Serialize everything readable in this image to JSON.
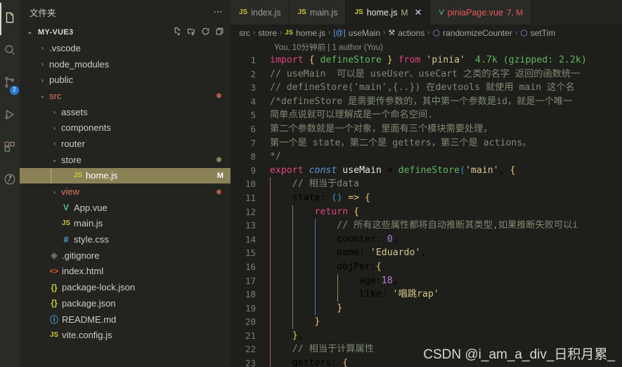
{
  "activitybar": {
    "items": [
      {
        "name": "explorer",
        "icon": "files-icon",
        "active": true,
        "badge": ""
      },
      {
        "name": "search",
        "icon": "search-icon",
        "active": false,
        "badge": ""
      },
      {
        "name": "source-control",
        "icon": "source-control-icon",
        "active": false,
        "badge": "2"
      },
      {
        "name": "run-and-debug",
        "icon": "run-debug-icon",
        "active": false,
        "badge": ""
      },
      {
        "name": "extensions",
        "icon": "extensions-icon",
        "active": false,
        "badge": ""
      },
      {
        "name": "testing",
        "icon": "testing-beaker-icon",
        "active": false,
        "badge": ""
      }
    ]
  },
  "sidebar": {
    "title": "文件夹",
    "more_label": "⋯",
    "project": "MY-VUE3",
    "actions": [
      "new-file-icon",
      "new-folder-icon",
      "refresh-icon",
      "collapse-all-icon"
    ],
    "tree": [
      {
        "label": ".vscode",
        "indent": 1,
        "kind": "folder",
        "twisty": "›",
        "color": "#ccccc6",
        "dot": "",
        "badge": ""
      },
      {
        "label": "node_modules",
        "indent": 1,
        "kind": "folder",
        "twisty": "›",
        "color": "#ccccc6",
        "dot": "",
        "badge": ""
      },
      {
        "label": "public",
        "indent": 1,
        "kind": "folder",
        "twisty": "›",
        "color": "#ccccc6",
        "dot": "",
        "badge": ""
      },
      {
        "label": "src",
        "indent": 1,
        "kind": "folder",
        "twisty": "⌄",
        "color": "#e07a5f",
        "dot": "#a85b45",
        "badge": ""
      },
      {
        "label": "assets",
        "indent": 2,
        "kind": "folder",
        "twisty": "›",
        "color": "#ccccc6",
        "dot": "",
        "badge": ""
      },
      {
        "label": "components",
        "indent": 2,
        "kind": "folder",
        "twisty": "›",
        "color": "#ccccc6",
        "dot": "",
        "badge": ""
      },
      {
        "label": "router",
        "indent": 2,
        "kind": "folder",
        "twisty": "›",
        "color": "#ccccc6",
        "dot": "",
        "badge": ""
      },
      {
        "label": "store",
        "indent": 2,
        "kind": "folder",
        "twisty": "⌄",
        "color": "#ccccc6",
        "dot": "#8e8455",
        "badge": ""
      },
      {
        "label": "home.js",
        "indent": 3,
        "kind": "js",
        "twisty": "",
        "color": "#ffffff",
        "dot": "",
        "badge": "M",
        "selected": true
      },
      {
        "label": "view",
        "indent": 2,
        "kind": "folder",
        "twisty": "›",
        "color": "#e07a5f",
        "dot": "#a85b45",
        "badge": ""
      },
      {
        "label": "App.vue",
        "indent": 2,
        "kind": "vue",
        "twisty": "",
        "color": "#ccccc6",
        "dot": "",
        "badge": ""
      },
      {
        "label": "main.js",
        "indent": 2,
        "kind": "js",
        "twisty": "",
        "color": "#ccccc6",
        "dot": "",
        "badge": ""
      },
      {
        "label": "style.css",
        "indent": 2,
        "kind": "css",
        "twisty": "",
        "color": "#ccccc6",
        "dot": "",
        "badge": ""
      },
      {
        "label": ".gitignore",
        "indent": 1,
        "kind": "git",
        "twisty": "",
        "color": "#ccccc6",
        "dot": "",
        "badge": ""
      },
      {
        "label": "index.html",
        "indent": 1,
        "kind": "html",
        "twisty": "",
        "color": "#ccccc6",
        "dot": "",
        "badge": ""
      },
      {
        "label": "package-lock.json",
        "indent": 1,
        "kind": "json",
        "twisty": "",
        "color": "#ccccc6",
        "dot": "",
        "badge": ""
      },
      {
        "label": "package.json",
        "indent": 1,
        "kind": "json",
        "twisty": "",
        "color": "#ccccc6",
        "dot": "",
        "badge": ""
      },
      {
        "label": "README.md",
        "indent": 1,
        "kind": "md",
        "twisty": "",
        "color": "#ccccc6",
        "dot": "",
        "badge": ""
      },
      {
        "label": "vite.config.js",
        "indent": 1,
        "kind": "js",
        "twisty": "",
        "color": "#ccccc6",
        "dot": "",
        "badge": ""
      }
    ]
  },
  "tabs": [
    {
      "label": "index.js",
      "icon": "js-icon",
      "flag": "",
      "active": false,
      "error": false,
      "closeable": false
    },
    {
      "label": "main.js",
      "icon": "js-icon",
      "flag": "",
      "active": false,
      "error": false,
      "closeable": false
    },
    {
      "label": "home.js",
      "icon": "js-icon",
      "flag": "M",
      "active": true,
      "error": false,
      "closeable": true,
      "close": "✕"
    },
    {
      "label": "piniaPage.vue",
      "icon": "vue-icon",
      "flag": "7, M",
      "active": false,
      "error": true,
      "closeable": false
    }
  ],
  "breadcrumb": [
    {
      "label": "src",
      "icon": ""
    },
    {
      "label": "store",
      "icon": ""
    },
    {
      "label": "home.js",
      "icon": "js-icon"
    },
    {
      "label": "useMain",
      "icon": "variable-icon"
    },
    {
      "label": "actions",
      "icon": "wrench-icon"
    },
    {
      "label": "randomizeCounter",
      "icon": "cube-icon"
    },
    {
      "label": "setTim",
      "icon": "cube-icon"
    }
  ],
  "editor": {
    "blame": "You, 10分钟前 | 1 author (You)",
    "import_cost": "4.7k (gzipped: 2.2k)",
    "watermark": "CSDN @i_am_a_div_日积月累_",
    "lines": [
      {
        "n": 1,
        "text": "import { defineStore } from 'pinia'"
      },
      {
        "n": 2,
        "text": "// useMain  可以是 useUser、useCart 之类的名字 返回的函数统一"
      },
      {
        "n": 3,
        "text": "// defineStore('main',{..}) 在devtools 就使用 main 这个名"
      },
      {
        "n": 4,
        "text": "/*defineStore 是需要传参数的，其中第一个参数是id，就是一个唯一"
      },
      {
        "n": 5,
        "text": "简单点说就可以理解成是一个命名空间."
      },
      {
        "n": 6,
        "text": "第二个参数就是一个对象，里面有三个模块需要处理，"
      },
      {
        "n": 7,
        "text": "第一个是 state，第二个是 getters，第三个是 actions。"
      },
      {
        "n": 8,
        "text": "*/"
      },
      {
        "n": 9,
        "text": "export const useMain = defineStore('main', {"
      },
      {
        "n": 10,
        "text": "    // 相当于data"
      },
      {
        "n": 11,
        "text": "    state: () => {"
      },
      {
        "n": 12,
        "text": "        return {"
      },
      {
        "n": 13,
        "text": "            // 所有这些属性都将自动推断其类型,如果推断失败可以i"
      },
      {
        "n": 14,
        "text": "            counter: 0,"
      },
      {
        "n": 15,
        "text": "            name: 'Eduardo',"
      },
      {
        "n": 16,
        "text": "            objPer:{"
      },
      {
        "n": 17,
        "text": "                age:18,"
      },
      {
        "n": 18,
        "text": "                like: '唱跳rap'"
      },
      {
        "n": 19,
        "text": "            }"
      },
      {
        "n": 20,
        "text": "        }"
      },
      {
        "n": 21,
        "text": "    },"
      },
      {
        "n": 22,
        "text": "    // 相当于计算属性"
      },
      {
        "n": 23,
        "text": "    getters: {"
      }
    ]
  },
  "colors": {
    "accent": "#8a8157",
    "badge": "#2b79d7",
    "modified": "#e07a5f",
    "error": "#e05a5a",
    "js_icon": "#c9c63a",
    "vue_icon": "#53c07d"
  }
}
